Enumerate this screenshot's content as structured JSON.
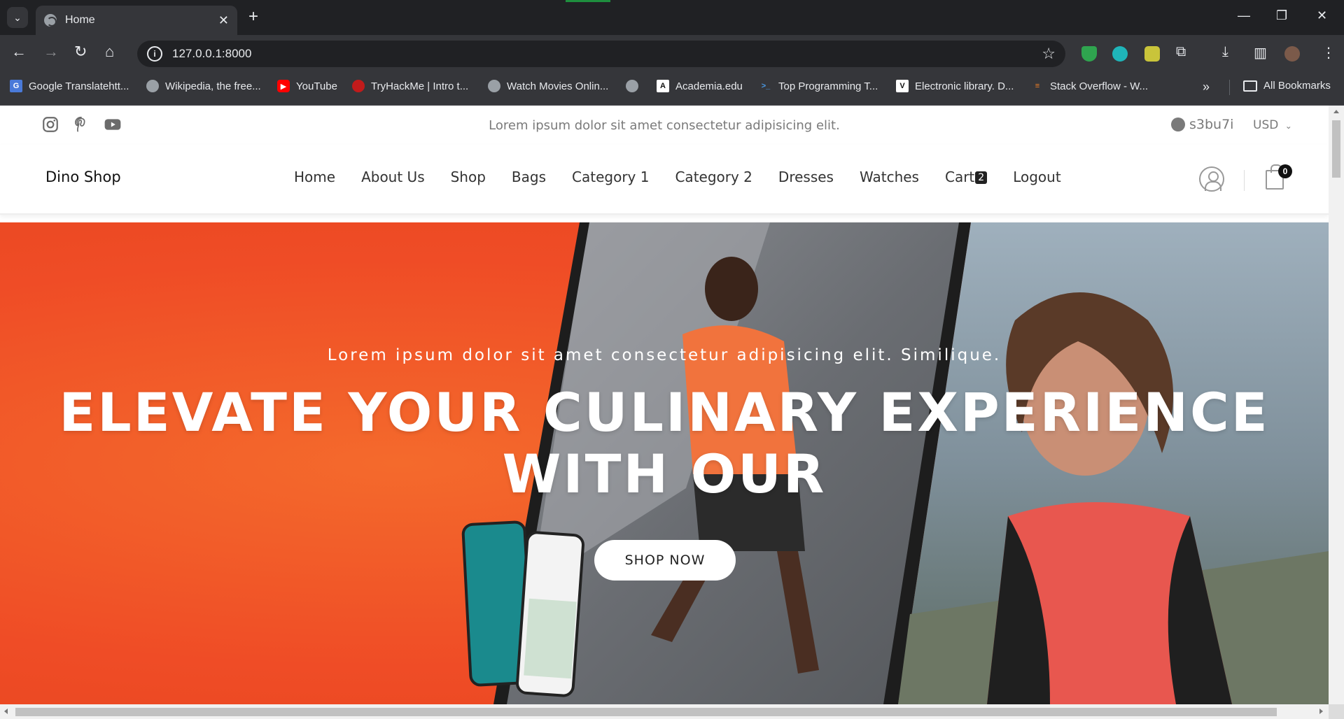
{
  "browser": {
    "tab_title": "Home",
    "url": "127.0.0.1:8000",
    "all_bookmarks_label": "All Bookmarks",
    "bookmarks": [
      {
        "label": "Google Translatehtt...",
        "icon": "google-translate-icon"
      },
      {
        "label": "Wikipedia, the free...",
        "icon": "globe-icon"
      },
      {
        "label": "YouTube",
        "icon": "youtube-icon"
      },
      {
        "label": "TryHackMe | Intro t...",
        "icon": "tryhackme-icon"
      },
      {
        "label": "Watch Movies Onlin...",
        "icon": "globe-icon"
      },
      {
        "label": "",
        "icon": "globe-icon"
      },
      {
        "label": "Academia.edu",
        "icon": "academia-icon"
      },
      {
        "label": "Top Programming T...",
        "icon": "terminal-icon"
      },
      {
        "label": "Electronic library. D...",
        "icon": "library-icon"
      },
      {
        "label": "Stack Overflow - W...",
        "icon": "stackoverflow-icon"
      }
    ]
  },
  "topbar": {
    "message": "Lorem ipsum dolor sit amet consectetur adipisicing elit.",
    "github_user": "s3bu7i",
    "currency": "USD"
  },
  "header": {
    "brand": "Dino Shop",
    "menu": [
      "Home",
      "About Us",
      "Shop",
      "Bags",
      "Category 1",
      "Category 2",
      "Dresses",
      "Watches"
    ],
    "cart_label": "Cart",
    "cart_count": "2",
    "logout_label": "Logout",
    "bag_count": "0"
  },
  "hero": {
    "subtitle": "Lorem ipsum dolor sit amet consectetur adipisicing elit. Similique.",
    "title": "ELEVATE YOUR CULINARY EXPERIENCE WITH OUR",
    "button_label": "SHOP NOW"
  },
  "colors": {
    "hero_orange": "#ef4c26",
    "chrome_dark": "#202124",
    "chrome_bar": "#35363a"
  }
}
